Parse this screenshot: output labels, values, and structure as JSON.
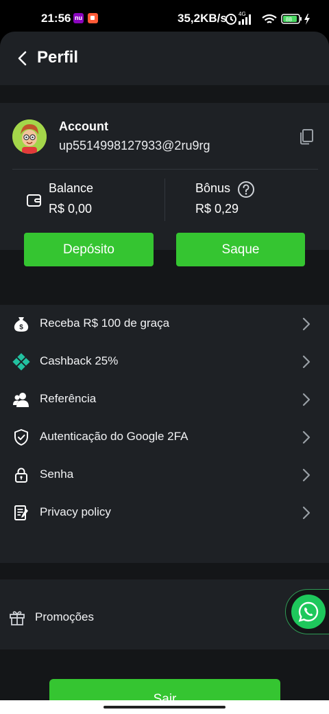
{
  "status_bar": {
    "time": "21:56",
    "nu_badge": "nu",
    "network_speed": "35,2KB/s",
    "network_type": "4G",
    "battery": "88"
  },
  "header": {
    "title": "Perfil",
    "back_icon": "chevron-left-icon"
  },
  "account": {
    "label": "Account",
    "id": "up5514998127933@2ru9rg",
    "copy_icon": "copy-icon"
  },
  "balance": {
    "label": "Balance",
    "value": "R$ 0,00"
  },
  "bonus": {
    "label": "Bônus",
    "value": "R$ 0,29"
  },
  "buttons": {
    "deposit": "Depósito",
    "withdraw": "Saque"
  },
  "menu": {
    "items": [
      {
        "label": "Receba R$ 100 de graça",
        "icon": "money-bag-icon"
      },
      {
        "label": "Cashback 25%",
        "icon": "diamond-icon"
      },
      {
        "label": "Referência",
        "icon": "users-icon"
      },
      {
        "label": "Autenticação do Google 2FA",
        "icon": "shield-icon"
      },
      {
        "label": "Senha",
        "icon": "lock-icon"
      },
      {
        "label": "Privacy policy",
        "icon": "document-icon"
      }
    ]
  },
  "promo": {
    "label": "Promoções",
    "icon": "gift-icon",
    "chat_icon": "whatsapp-icon"
  },
  "logout": {
    "label": "Sair"
  },
  "colors": {
    "accent": "#35c531",
    "background": "#141618",
    "card": "#1e2125",
    "cashback_icon": "#22c1a0",
    "whatsapp": "#1ec85c"
  }
}
